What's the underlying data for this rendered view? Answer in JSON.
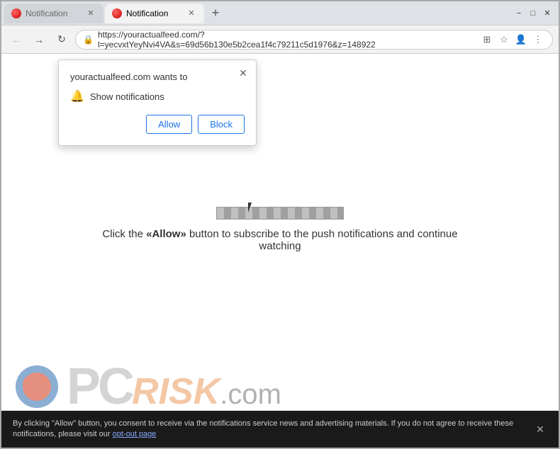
{
  "browser": {
    "tabs": [
      {
        "id": "tab1",
        "title": "Notification",
        "active": false,
        "favicon": "notification-icon"
      },
      {
        "id": "tab2",
        "title": "Notification",
        "active": true,
        "favicon": "notification-icon"
      }
    ],
    "new_tab_label": "+",
    "address": "https://youractualfeed.com/?l=yecvxtYeyNvi4VA&s=69d56b130e5b2cea1f4c79211c5d1976&z=148922",
    "window_controls": {
      "minimize": "−",
      "maximize": "□",
      "close": "✕"
    }
  },
  "notification_popup": {
    "title": "youractualfeed.com wants to",
    "notification_label": "Show notifications",
    "allow_label": "Allow",
    "block_label": "Block",
    "close_label": "✕"
  },
  "page": {
    "instruction": "Click the «Allow» button to subscribe to the push notifications and continue watching"
  },
  "consent_bar": {
    "text": "By clicking \"Allow\" button, you consent to receive via the notifications service news and advertising materials. If you do not agree to receive these notifications, please visit our opt-out page",
    "opt_out_label": "opt-out page",
    "close_label": "✕"
  },
  "watermark": {
    "pc_text": "PC",
    "risk_text": "RISK",
    "com_text": ".com"
  },
  "icons": {
    "lock": "🔒",
    "bell": "🔔",
    "back": "←",
    "forward": "→",
    "refresh": "↻",
    "grid": "⊞",
    "star": "☆",
    "person": "👤",
    "menu": "⋮"
  }
}
